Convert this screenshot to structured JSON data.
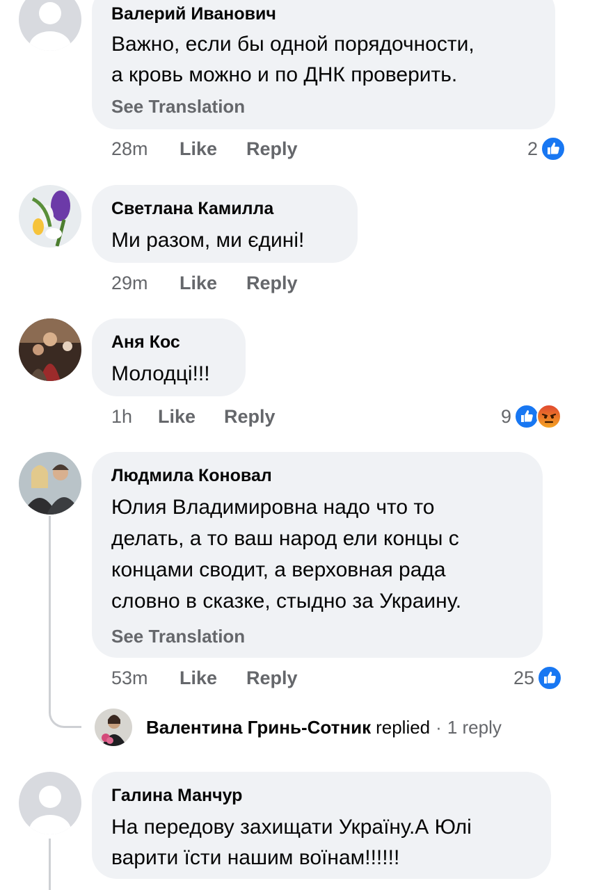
{
  "comments": [
    {
      "author": "Валерий Иванович",
      "lines": [
        "Важно, если бы одной порядочности,",
        "а кровь можно и по ДНК проверить."
      ],
      "see_translation": "See Translation",
      "time": "28m",
      "like": "Like",
      "reply": "Reply",
      "reaction_count": "2",
      "reactions": [
        "like-icon"
      ],
      "avatar": "default-avatar"
    },
    {
      "author": "Светлана Камилла",
      "lines": [
        "Ми разом, ми єдині!"
      ],
      "time": "29m",
      "like": "Like",
      "reply": "Reply",
      "avatar": "flowers-photo"
    },
    {
      "author": "Аня Кос",
      "lines": [
        "Молодці!!!"
      ],
      "time": "1h",
      "like": "Like",
      "reply": "Reply",
      "reaction_count": "9",
      "reactions": [
        "like-icon",
        "angry-icon"
      ],
      "avatar": "people-photo"
    },
    {
      "author": "Людмила Коновал",
      "lines": [
        "Юлия Владимировна надо что то",
        "делать, а то ваш народ ели концы с",
        "концами сводит, а верховная рада",
        "словно в сказке, стыдно за Украину."
      ],
      "see_translation": "See Translation",
      "time": "53m",
      "like": "Like",
      "reply": "Reply",
      "reaction_count": "25",
      "reactions": [
        "like-icon"
      ],
      "avatar": "two-women-photo",
      "reply_summary": {
        "name": "Валентина Гринь-Сотник",
        "word": "replied",
        "dot": "·",
        "count": "1 reply"
      }
    },
    {
      "author": "Галина Манчур",
      "lines": [
        "На передову захищати Україну.А Юлі",
        "варити їсти  нашим воїнам!!!!!!"
      ],
      "avatar": "default-avatar"
    }
  ],
  "colors": {
    "bubble": "#f0f2f5",
    "secondary_text": "#65676b",
    "like_blue": "#1877f2",
    "angry_orange": "#e9710f"
  }
}
